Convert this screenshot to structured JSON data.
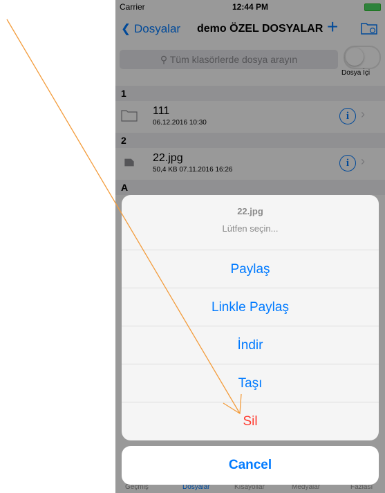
{
  "status": {
    "carrier": "Carrier",
    "time": "12:44 PM"
  },
  "nav": {
    "back_label": "Dosyalar",
    "title": "demo ÖZEL DOSYALAR",
    "plus_label": "+"
  },
  "search": {
    "placeholder": "Tüm klasörlerde dosya arayın",
    "toggle_label": "Dosya İçi"
  },
  "sections": [
    {
      "header": "1",
      "item": {
        "name": "111",
        "meta": "06.12.2016 10:30"
      }
    },
    {
      "header": "2",
      "item": {
        "name": "22.jpg",
        "meta": "50,4 KB   07.11.2016 16:26"
      }
    },
    {
      "header": "A"
    }
  ],
  "tabs": [
    {
      "label": "Geçmiş"
    },
    {
      "label": "Dosyalar",
      "active": true
    },
    {
      "label": "Kısayollar"
    },
    {
      "label": "Medyalar"
    },
    {
      "label": "Fazlası"
    }
  ],
  "action_sheet": {
    "title": "22.jpg",
    "subtitle": "Lütfen seçin...",
    "actions": [
      "Paylaş",
      "Linkle Paylaş",
      "İndir",
      "Taşı",
      "Sil"
    ],
    "cancel": "Cancel"
  },
  "colors": {
    "accent": "#007aff",
    "destructive": "#ff3b30",
    "annotation": "#f39c3c"
  }
}
